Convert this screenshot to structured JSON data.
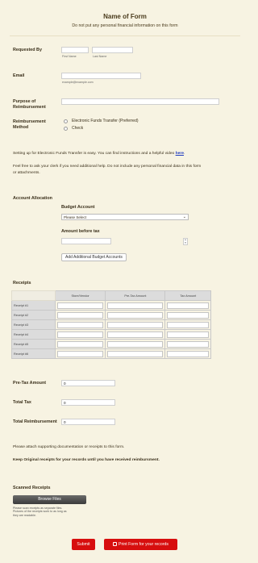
{
  "form": {
    "title": "Name of Form",
    "subtitle": "Do not put any personal financial information on this form"
  },
  "requested_by": {
    "label": "Requested By",
    "first_sub": "First Name",
    "last_sub": "Last Name",
    "first_value": "",
    "last_value": ""
  },
  "email": {
    "label": "Email",
    "value": "",
    "sub": "example@example.com"
  },
  "purpose": {
    "label_line1": "Purpose of",
    "label_line2": "Reimbursement",
    "value": ""
  },
  "reimbursement_method": {
    "label_line1": "Reimbursement",
    "label_line2": "Method",
    "options": [
      "Electronic Funds Transfer (Preferred)",
      "Check"
    ]
  },
  "info": {
    "eft_text": "Setting up for Electronic Funds Transfer is easy. You can find instructions and a helpful video",
    "eft_link": "here",
    "eft_end": ".",
    "help_line1": "Feel free to ask your clerk if you need additional help. Do not include any personal financial data in this form",
    "help_line2": "or attachments."
  },
  "account_allocation": {
    "label": "Account Allocation",
    "budget_label": "Budget Account",
    "budget_selected": "Please Select",
    "amount_label": "Amount before tax",
    "amount_value": "",
    "add_button": "Add Additional Budget Accounts"
  },
  "receipts": {
    "label": "Receipts",
    "columns": [
      "Store/Vendor",
      "Pre-Tax Amount",
      "Tax Amount"
    ],
    "rows": [
      "Receipt #1",
      "Receipt #2",
      "Receipt #3",
      "Receipt #4",
      "Receipt #5",
      "Receipt #6"
    ]
  },
  "totals": {
    "pretax_label": "Pre-Tax Amount",
    "pretax_value": "0",
    "tax_label": "Total Tax",
    "tax_value": "0",
    "reimb_label": "Total Reimbursement",
    "reimb_value": "0"
  },
  "attach": {
    "line1": "Please attach supporting documentation or receipts to this form.",
    "line2": "Keep Original receipts for your records until you have received reimbursment."
  },
  "scanned": {
    "label": "Scanned Receipts",
    "browse": "Browse Files",
    "note_line1": "Please scan receipts as separate files.",
    "note_line2": "Pictures of the receipts work to as long as",
    "note_line3": "they are readable."
  },
  "actions": {
    "submit": "Submit",
    "print": "Print Form for your records"
  },
  "colors": {
    "background": "#f7f3e2",
    "accent_red": "#d70e0e",
    "link_blue": "#1f3bbf"
  }
}
